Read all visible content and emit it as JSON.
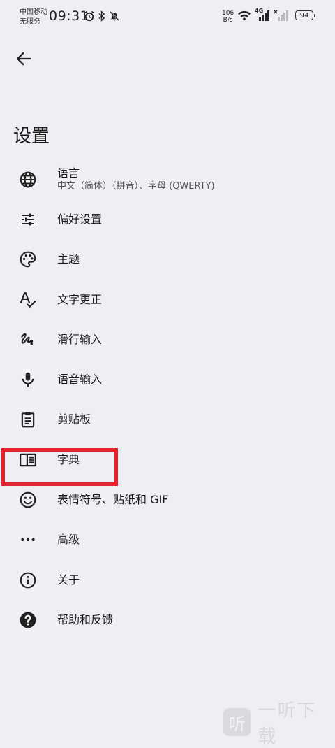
{
  "status_bar": {
    "carrier_line1": "中国移动",
    "carrier_line2": "无服务",
    "time": "09:31",
    "speed_value": "106",
    "speed_unit": "B/s",
    "network": "4G",
    "battery": "94"
  },
  "header": {
    "back_icon": "arrow-left-icon",
    "title": "设置"
  },
  "menu": {
    "items": [
      {
        "label": "语言",
        "sub": "中文（简体）（拼音）、字母 (QWERTY)",
        "icon": "globe-icon"
      },
      {
        "label": "偏好设置",
        "icon": "tune-sliders-icon"
      },
      {
        "label": "主题",
        "icon": "palette-icon"
      },
      {
        "label": "文字更正",
        "icon": "spellcheck-icon"
      },
      {
        "label": "滑行输入",
        "icon": "gesture-icon"
      },
      {
        "label": "语音输入",
        "icon": "microphone-icon"
      },
      {
        "label": "剪贴板",
        "icon": "clipboard-icon"
      },
      {
        "label": "字典",
        "icon": "dictionary-book-icon"
      },
      {
        "label": "表情符号、贴纸和 GIF",
        "icon": "emoji-icon"
      },
      {
        "label": "高级",
        "icon": "more-dots-icon"
      },
      {
        "label": "关于",
        "icon": "info-icon"
      },
      {
        "label": "帮助和反馈",
        "icon": "help-icon"
      }
    ]
  },
  "highlight_color": "#e4232b",
  "watermark": {
    "logo_glyph": "听",
    "text": "一听下载"
  }
}
